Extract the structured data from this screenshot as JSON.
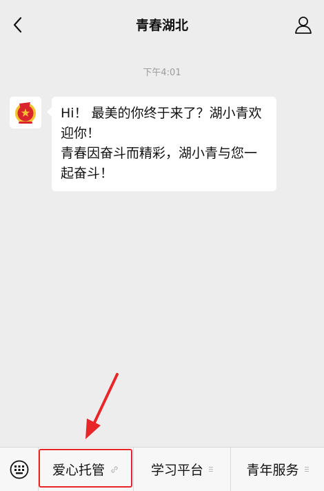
{
  "header": {
    "title": "青春湖北",
    "back_icon": "chevron-left-icon",
    "profile_icon": "person-icon"
  },
  "chat": {
    "timestamp": "下午4:01",
    "message": {
      "sender_avatar": "communist-youth-league-emblem",
      "line1": "Hi！ 最美的你终于来了？湖小青欢",
      "line2": "迎你！",
      "line3": "青春因奋斗而精彩，湖小青与您一",
      "line4": "起奋斗！"
    }
  },
  "menu": {
    "keyboard_icon": "keyboard-icon",
    "items": [
      {
        "label": "爱心托管",
        "suffix_icon": "link-icon"
      },
      {
        "label": "学习平台",
        "suffix_icon": "submenu-lines-icon"
      },
      {
        "label": "青年服务",
        "suffix_icon": "submenu-lines-icon"
      }
    ]
  },
  "colors": {
    "background": "#ededed",
    "bubble": "#ffffff",
    "highlight": "#e8262a",
    "annotation_arrow": "#e8262a"
  }
}
